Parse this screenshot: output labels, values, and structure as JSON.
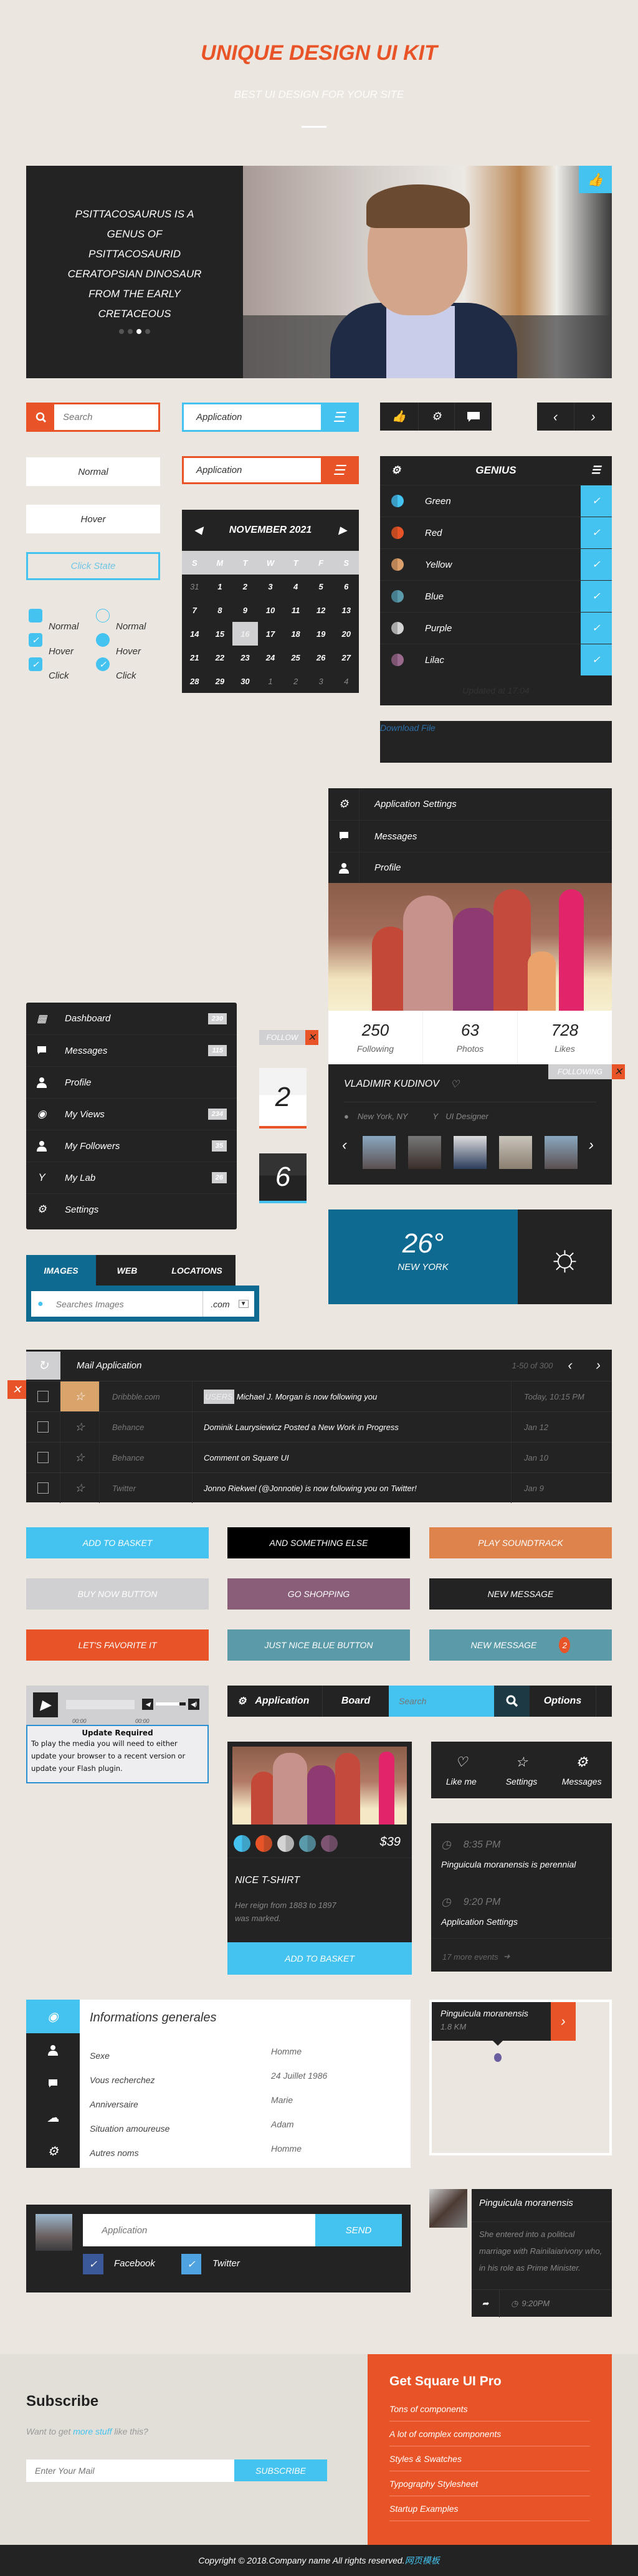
{
  "header": {
    "title": "UNIQUE DESIGN UI KIT",
    "subtitle": "BEST UI DESIGN FOR YOUR SITE"
  },
  "hero": {
    "lines": [
      "PSITTACOSAURUS IS A",
      "GENUS OF",
      "PSITTACOSAURID",
      "CERATOPSIAN DINOSAUR",
      "FROM THE EARLY",
      "CRETACEOUS"
    ],
    "slides": 4,
    "active_slide": 3,
    "like_icon": "thumbs-up-icon"
  },
  "inputs": {
    "search_placeholder": "Search",
    "app_blue": "Application",
    "app_orange": "Application",
    "normal": "Normal",
    "hover": "Hover",
    "click": "Click State"
  },
  "checks": {
    "checkbox": [
      "Normal",
      "Hover",
      "Click"
    ],
    "radio": [
      "Normal",
      "Hover",
      "Click"
    ]
  },
  "calendar": {
    "month": "NOVEMBER 2021",
    "weekdays": [
      "S",
      "M",
      "T",
      "W",
      "T",
      "F",
      "S"
    ],
    "days": [
      "31",
      "1",
      "2",
      "3",
      "4",
      "5",
      "6",
      "7",
      "8",
      "9",
      "10",
      "11",
      "12",
      "13",
      "14",
      "15",
      "16",
      "17",
      "18",
      "19",
      "20",
      "21",
      "22",
      "23",
      "24",
      "25",
      "26",
      "27",
      "28",
      "29",
      "30",
      "1",
      "2",
      "3",
      "4"
    ],
    "selected": "16"
  },
  "genius": {
    "title": "GENIUS",
    "items": [
      {
        "label": "Green",
        "color": "#44c3f0",
        "shade": "#3a9cc5"
      },
      {
        "label": "Red",
        "color": "#e85427",
        "shade": "#c44a22"
      },
      {
        "label": "Yellow",
        "color": "#dba06b",
        "shade": "#b98556"
      },
      {
        "label": "Blue",
        "color": "#5a9aab",
        "shade": "#487f8e"
      },
      {
        "label": "Purple",
        "color": "#d4d4d4",
        "shade": "#a8a8a8"
      },
      {
        "label": "Lilac",
        "color": "#9a6a8e",
        "shade": "#7d5573"
      }
    ],
    "updated": "Updated at 17:04"
  },
  "download": "Download File",
  "app_menu": [
    "Application Settings",
    "Messages",
    "Profile"
  ],
  "profile": {
    "stats": [
      {
        "value": "250",
        "label": "Following"
      },
      {
        "value": "63",
        "label": "Photos"
      },
      {
        "value": "728",
        "label": "Likes"
      }
    ],
    "following": "FOLLOWING",
    "name": "VLADIMIR KUDINOV",
    "location": "New York, NY",
    "role": "UI Designer"
  },
  "follow": "FOLLOW",
  "tiles": [
    "2",
    "6"
  ],
  "sidebar": [
    {
      "label": "Dashboard",
      "badge": "230",
      "icon": "calendar-icon"
    },
    {
      "label": "Messages",
      "badge": "115",
      "icon": "chat-icon"
    },
    {
      "label": "Profile",
      "badge": "",
      "icon": "user-icon"
    },
    {
      "label": "My Views",
      "badge": "234",
      "icon": "eye-icon"
    },
    {
      "label": "My Followers",
      "badge": "35",
      "icon": "user-icon"
    },
    {
      "label": "My Lab",
      "badge": "26",
      "icon": "cocktail-icon"
    },
    {
      "label": "Settings",
      "badge": "",
      "icon": "gear-icon"
    }
  ],
  "weather": {
    "temp": "26°",
    "city": "NEW YORK"
  },
  "search_tabs": {
    "tabs": [
      "IMAGES",
      "WEB",
      "LOCATIONS"
    ],
    "placeholder": "Searches Images",
    "domain": ".com"
  },
  "mail": {
    "title": "Mail Application",
    "range": "1-50 of 300",
    "rows": [
      {
        "source": "Dribbble.com",
        "tag": "USERS",
        "subject": "Michael J. Morgan is now following you",
        "date": "Today, 10:15 PM",
        "starred": true
      },
      {
        "source": "Behance",
        "subject": "Dominik Laurysiewicz Posted a New Work in Progress",
        "date": "Jan 12"
      },
      {
        "source": "Behance",
        "subject": "Comment on Square UI",
        "date": "Jan 10"
      },
      {
        "source": "Twitter",
        "subject": "Jonno Riekwel (@Jonnotie) is now following you on Twitter!",
        "date": "Jan 9"
      }
    ]
  },
  "buttons": [
    {
      "label": "ADD TO BASKET",
      "color": "#44c3f0"
    },
    {
      "label": "AND SOMETHING ELSE",
      "color": "#000000"
    },
    {
      "label": "PLAY SOUNDTRACK",
      "color": "#df834d"
    },
    {
      "label": "BUY NOW BUTTON",
      "color": "#d0d0d2"
    },
    {
      "label": "GO SHOPPING",
      "color": "#8a5e78"
    },
    {
      "label": "NEW MESSAGE",
      "color": "#232323"
    },
    {
      "label": "LET'S FAVORITE IT",
      "color": "#e85427"
    },
    {
      "label": "JUST NICE BLUE BUTTON",
      "color": "#5b9aa8"
    },
    {
      "label": "NEW MESSAGE",
      "color": "#5b9aa8",
      "count": "2"
    }
  ],
  "player": {
    "time1": "00:00",
    "time2": "00:00",
    "update_title": "Update Required",
    "update_text": "To play the media you will need to either update your browser to a recent version or update your Flash plugin."
  },
  "appbar": {
    "application": "Application",
    "board": "Board",
    "search_placeholder": "Search",
    "options": "Options"
  },
  "product": {
    "price": "$39",
    "title": "NICE T-SHIRT",
    "desc": "Her reign from 1883 to 1897 was marked.",
    "button": "ADD TO BASKET",
    "swatches": [
      "#44c3f0",
      "#e85427",
      "#d4d4d4",
      "#5a9aab",
      "#7d5573"
    ]
  },
  "actions": [
    "Like me",
    "Settings",
    "Messages"
  ],
  "events": {
    "items": [
      {
        "time": "8:35 PM",
        "text": "Pinguicula moranensis is perennial"
      },
      {
        "time": "9:20 PM",
        "text": "Application Settings"
      }
    ],
    "more": "17 more events"
  },
  "info": {
    "title": "Informations generales",
    "labels": [
      "Sexe",
      "Vous recherchez",
      "Anniversaire",
      "Situation amoureuse",
      "Autres noms"
    ],
    "values": [
      "Homme",
      "24 Juillet 1986",
      "Marie",
      "Adam",
      "Homme"
    ]
  },
  "map": {
    "place": "Pinguicula moranensis",
    "distance": "1.8 KM"
  },
  "comment": {
    "placeholder": "Application",
    "send": "SEND",
    "facebook": "Facebook",
    "twitter": "Twitter"
  },
  "card": {
    "title": "Pinguicula moranensis",
    "text": "She entered into a political marriage with Rainilaiarivony who, in his role as Prime Minister.",
    "time": "9:20PM"
  },
  "subscribe": {
    "title": "Subscribe",
    "text_before": "Want to get ",
    "link": "more stuff",
    "text_after": " like this?",
    "placeholder": "Enter Your Mail",
    "button": "SUBSCRIBE"
  },
  "pro": {
    "title": "Get Square UI Pro",
    "items": [
      "Tons of components",
      "A lot of complex components",
      "Styles & Swatches",
      "Typography Stylesheet",
      "Startup Examples"
    ]
  },
  "footer": {
    "copyright": "Copyright © 2018.Company name All rights reserved.",
    "link": "网页模板"
  }
}
